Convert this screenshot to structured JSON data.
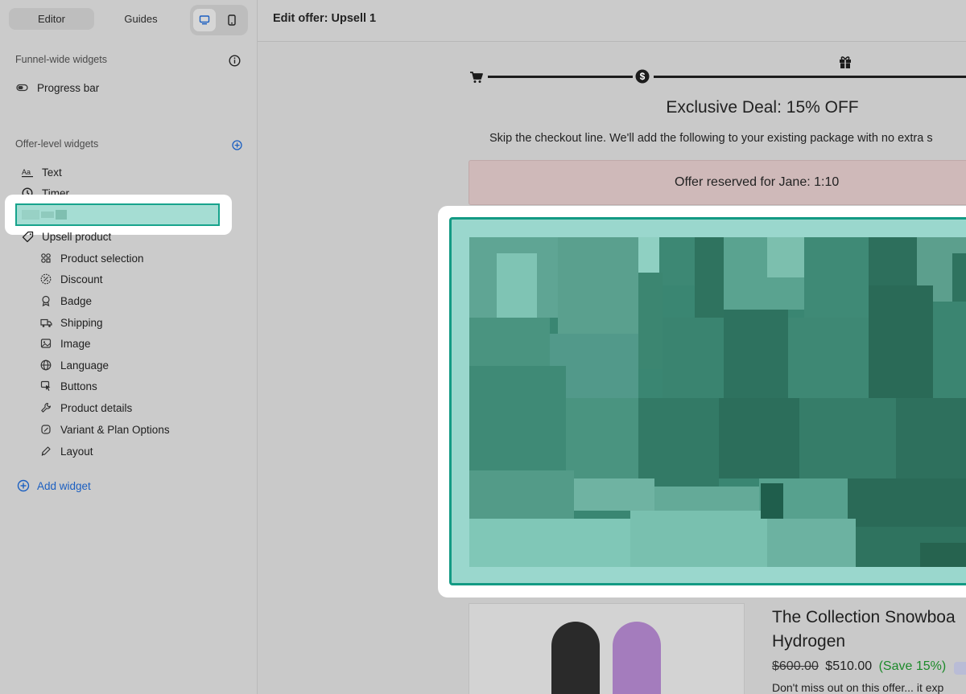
{
  "sidebar": {
    "tabs": [
      {
        "label": "Editor"
      },
      {
        "label": "Guides"
      }
    ],
    "sections": {
      "funnel": {
        "title": "Funnel-wide widgets"
      },
      "offer": {
        "title": "Offer-level widgets"
      }
    },
    "funnel_items": [
      {
        "label": "Progress bar",
        "icon": "toggle-icon"
      }
    ],
    "offer_items": [
      {
        "label": "Text",
        "icon": "text-icon"
      },
      {
        "label": "Timer",
        "icon": "clock-icon"
      },
      {
        "label": "Upsell product",
        "icon": "tag-icon"
      }
    ],
    "sub_items": [
      {
        "label": "Product selection",
        "icon": "product-selection-icon"
      },
      {
        "label": "Discount",
        "icon": "discount-icon"
      },
      {
        "label": "Badge",
        "icon": "badge-icon"
      },
      {
        "label": "Shipping",
        "icon": "truck-icon"
      },
      {
        "label": "Image",
        "icon": "image-icon"
      },
      {
        "label": "Language",
        "icon": "globe-icon"
      },
      {
        "label": "Buttons",
        "icon": "cursor-icon"
      },
      {
        "label": "Product details",
        "icon": "wrench-icon"
      },
      {
        "label": "Variant & Plan Options",
        "icon": "variant-icon"
      },
      {
        "label": "Layout",
        "icon": "pen-icon"
      }
    ],
    "add_widget": "Add widget"
  },
  "header": {
    "title": "Edit offer: Upsell 1"
  },
  "preview": {
    "deal_title": "Exclusive Deal: 15% OFF",
    "deal_subtitle": "Skip the checkout line. We'll add the following to your existing package with no extra s",
    "reserved_text": "Offer reserved for Jane: 1:10",
    "product": {
      "name_line1": "The Collection Snowboa",
      "name_line2": "Hydrogen",
      "price_old": "$600.00",
      "price_new": "$510.00",
      "price_save": "(Save 15%)",
      "promo": "Don't miss out on this offer... it exp"
    }
  },
  "colors": {
    "accent_teal": "#17a38c",
    "link_blue": "#1b5fc1",
    "save_green": "#1c8a2a",
    "reserved_bg": "#cfb9b9"
  }
}
